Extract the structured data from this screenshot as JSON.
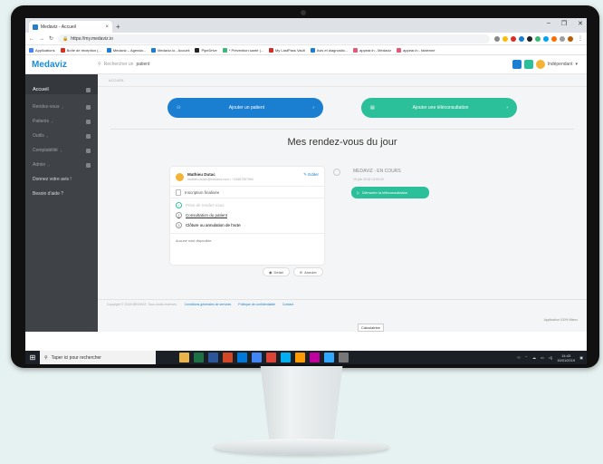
{
  "browser": {
    "tab_title": "Medaviz - Accueil",
    "url": "https://my.medaviz.io",
    "bookmarks": [
      {
        "label": "Applications",
        "color": "#4285f4"
      },
      {
        "label": "Boîte de réception (...",
        "color": "#d93025"
      },
      {
        "label": "Medaviz – Agenda...",
        "color": "#1a7fd0"
      },
      {
        "label": "Medaviz.io - Accueil",
        "color": "#1a7fd0"
      },
      {
        "label": "PipeDrive",
        "color": "#222222"
      },
      {
        "label": "* Prévention santé |...",
        "color": "#3cb878"
      },
      {
        "label": "My LastPass Vault",
        "color": "#d32d27"
      },
      {
        "label": "Avis et diagnostic...",
        "color": "#1a7fd0"
      },
      {
        "label": "appear.in - Medaviz",
        "color": "#e05a7a"
      },
      {
        "label": "appear.in - fabienne",
        "color": "#e05a7a"
      }
    ]
  },
  "app": {
    "logo": "Medaviz",
    "search_placeholder_prefix": "Rechercher un",
    "search_placeholder_bold": "patient",
    "user_label": "Indépendant",
    "sidebar": [
      {
        "label": "Accueil",
        "active": true
      },
      {
        "label": "Rendez-vous",
        "caret": "›"
      },
      {
        "label": "Patients",
        "caret": "›"
      },
      {
        "label": "Outils",
        "caret": "›"
      },
      {
        "label": "Comptabilité",
        "caret": "›"
      },
      {
        "label": "Admin",
        "caret": "›"
      },
      {
        "label": "Donnez votre avis !",
        "light": true
      },
      {
        "label": "Besoin d'aide ?",
        "light": true
      }
    ],
    "breadcrumb": "ACCUEIL",
    "action_add_patient": "Ajouter un patient",
    "action_add_tele": "Ajouter une téléconsultation",
    "page_title": "Mes rendez-vous du jour",
    "card": {
      "patient_name": "Mathieu Dutac",
      "patient_contact": "mathieu.dutac@medaviz.com  •  +33687557564",
      "edit_label": "Editer",
      "inscription": "Inscription finalisée",
      "steps": [
        {
          "num": "✓",
          "label": "Prise de rendez-vous",
          "state": "done"
        },
        {
          "num": "2",
          "label": "Consultation du patient",
          "state": "current"
        },
        {
          "num": "3",
          "label": "Clôture ou annulation de l'acte",
          "state": "todo"
        }
      ],
      "no_report": "Aucune note disponible",
      "detail_label": "Détail",
      "cancel_label": "Annuler"
    },
    "status": {
      "title": "MEDAVIZ - EN COURS",
      "date": "15 juin 2018 13:00:00",
      "start_tele": "Démarrer la téléconsultation"
    },
    "footer": {
      "copyright": "Copyright © 2018 MEDAVIZ. Tous droits réservés.",
      "terms": "Conditions générales de services",
      "privacy": "Politique de confidentialité",
      "contact": "Contact",
      "version": "Application 100% Mieux",
      "tooltip": "Calculatrice"
    }
  },
  "taskbar": {
    "search_placeholder": "Taper ici pour rechercher",
    "time": "14:43",
    "date": "15/01/2019",
    "apps": [
      "#e9b44c",
      "#1e7145",
      "#2b579a",
      "#d24726",
      "#0078d7",
      "#4285f4",
      "#db4437",
      "#00aff0",
      "#ff9a00",
      "#c0009e",
      "#31a8ff",
      "#777777"
    ]
  }
}
